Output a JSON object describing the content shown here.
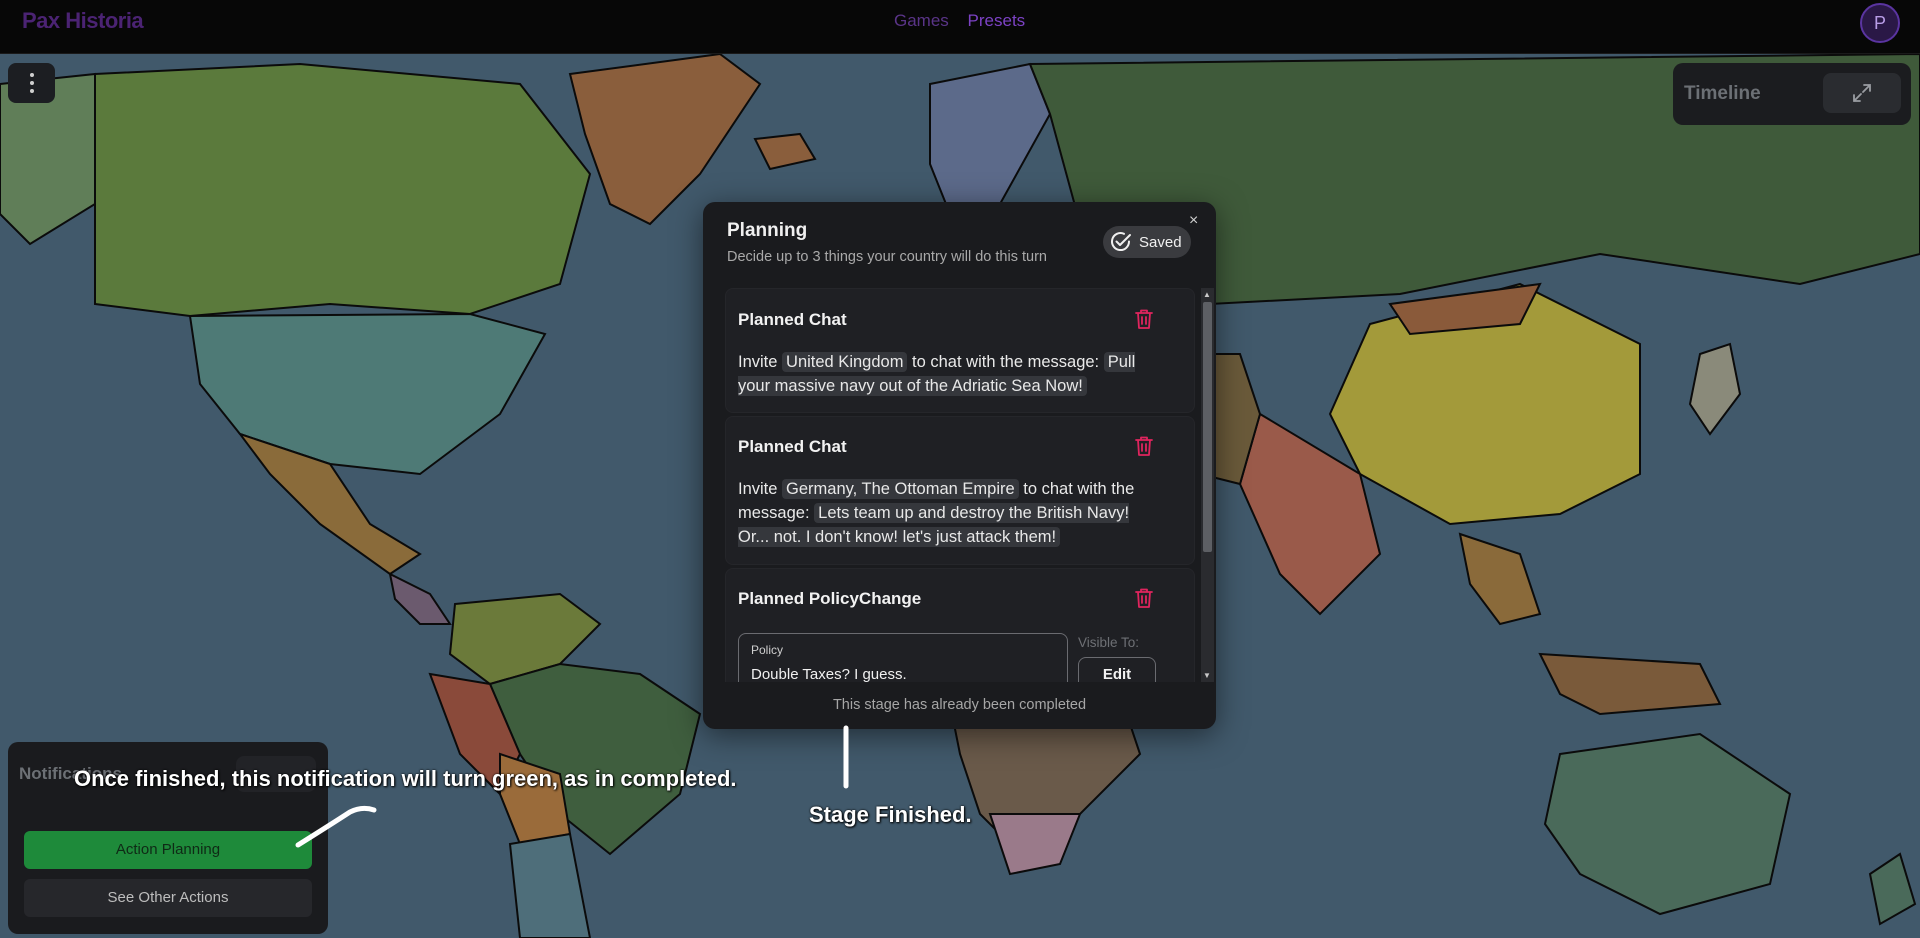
{
  "header": {
    "logo": "Pax Historia",
    "nav": [
      "Games",
      "Presets"
    ],
    "avatar_initial": "P"
  },
  "timeline": {
    "label": "Timeline"
  },
  "modal": {
    "title": "Planning",
    "subtitle": "Decide up to 3 things your country will do this turn",
    "saved_label": "Saved",
    "close": "×",
    "cards": [
      {
        "title": "Planned Chat",
        "invite_prefix": "Invite",
        "invitees": "United Kingdom",
        "connector": "to chat with the message:",
        "message": "Pull your massive navy out of the Adriatic Sea Now!"
      },
      {
        "title": "Planned Chat",
        "invite_prefix": "Invite",
        "invitees": "Germany, The Ottoman Empire",
        "connector": "to chat with the message:",
        "message": "Lets team up and destroy the British Navy! Or... not. I don't know! let's just attack them!"
      },
      {
        "title": "Planned PolicyChange",
        "policy_label": "Policy",
        "policy_value": "Double Taxes? I guess.",
        "visible_to": "Visible To:",
        "edit_label": "Edit"
      }
    ],
    "footer": "This stage has already been completed"
  },
  "notifications": {
    "title": "Notifications",
    "buttons": [
      "Action Planning",
      "See Other Actions"
    ]
  },
  "annotations": {
    "notification_note": "Once finished, this notification will turn green, as in completed.",
    "stage_note": "Stage Finished."
  },
  "colors": {
    "accent_purple": "#7c42c4",
    "completed_green": "#1e8a3a",
    "trash_red": "#e0245e"
  }
}
